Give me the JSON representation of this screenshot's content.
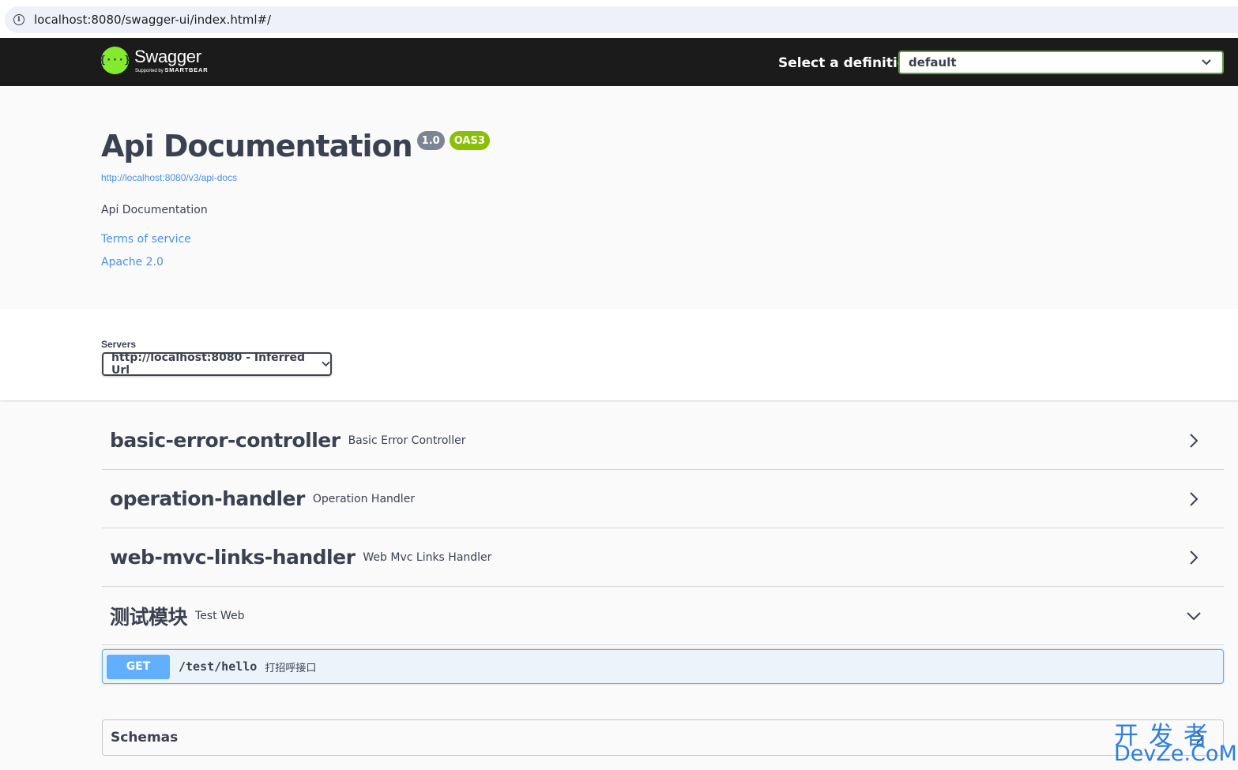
{
  "browser": {
    "url": "localhost:8080/swagger-ui/index.html#/"
  },
  "topbar": {
    "logo_name": "Swagger",
    "logo_sub_prefix": "Supported by",
    "logo_sub_brand": "SMARTBEAR",
    "definition_label": "Select a definition",
    "definition_selected": "default"
  },
  "info": {
    "title": "Api Documentation",
    "version": "1.0",
    "spec_badge": "OAS3",
    "doc_url": "http://localhost:8080/v3/api-docs",
    "description": "Api Documentation",
    "terms_link": "Terms of service",
    "license_link": "Apache 2.0"
  },
  "servers": {
    "label": "Servers",
    "selected": "http://localhost:8080 - Inferred Url"
  },
  "tags": [
    {
      "name": "basic-error-controller",
      "description": "Basic Error Controller",
      "expanded": false
    },
    {
      "name": "operation-handler",
      "description": "Operation Handler",
      "expanded": false
    },
    {
      "name": "web-mvc-links-handler",
      "description": "Web Mvc Links Handler",
      "expanded": false
    },
    {
      "name": "测试模块",
      "description": "Test Web",
      "expanded": true
    }
  ],
  "operation": {
    "method": "GET",
    "path": "/test/hello",
    "summary": "打招呼接口"
  },
  "schemas": {
    "title": "Schemas"
  },
  "watermark": {
    "cn": "开发者",
    "en": "DevZe.CoM"
  },
  "colors": {
    "topbar_bg": "#1b1b1b",
    "logo_green": "#85ea2d",
    "get_blue": "#61affe",
    "link_blue": "#4990e2",
    "oas_badge": "#89bf04",
    "version_badge": "#7d8492"
  },
  "icons": [
    "info-icon",
    "chevron-down-icon",
    "chevron-right-icon",
    "swagger-logo-icon"
  ]
}
